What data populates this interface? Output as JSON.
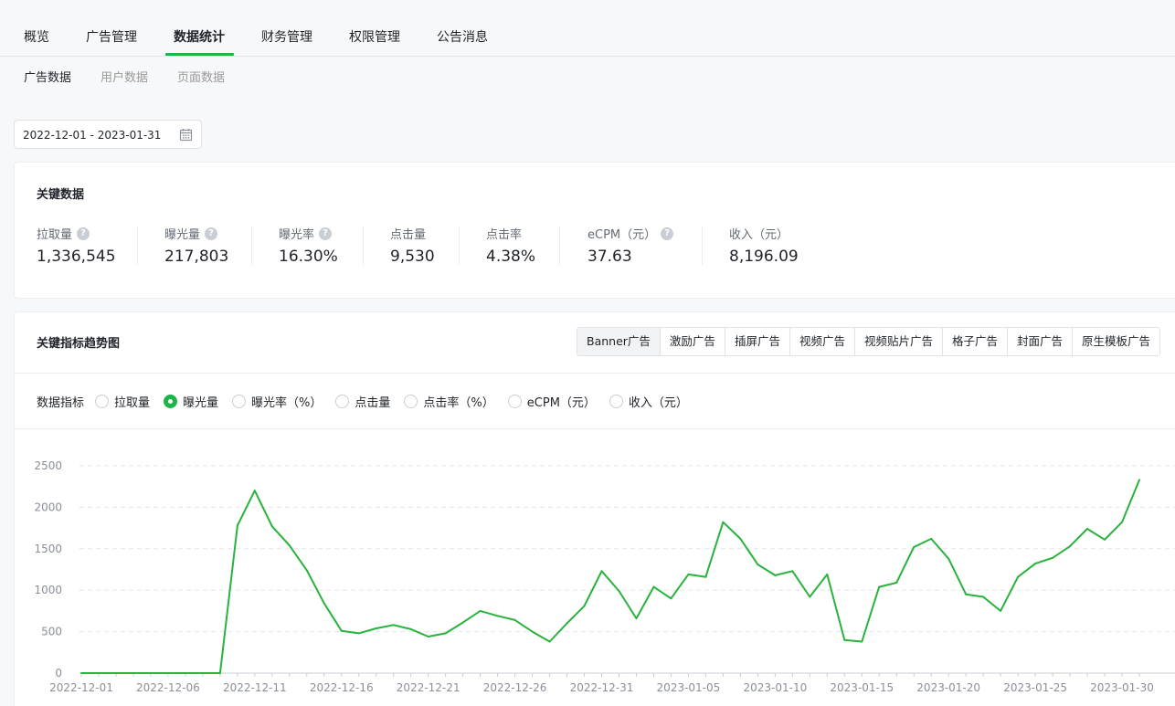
{
  "topnav": {
    "items": [
      {
        "label": "概览"
      },
      {
        "label": "广告管理"
      },
      {
        "label": "数据统计",
        "active": true
      },
      {
        "label": "财务管理"
      },
      {
        "label": "权限管理"
      },
      {
        "label": "公告消息"
      }
    ]
  },
  "subnav": {
    "items": [
      {
        "label": "广告数据",
        "active": true
      },
      {
        "label": "用户数据"
      },
      {
        "label": "页面数据"
      }
    ]
  },
  "date_range": {
    "value": "2022-12-01 - 2023-01-31",
    "icon": "calendar-icon"
  },
  "key_data": {
    "title": "关键数据",
    "metrics": [
      {
        "label": "拉取量",
        "value": "1,336,545",
        "help": true
      },
      {
        "label": "曝光量",
        "value": "217,803",
        "help": true
      },
      {
        "label": "曝光率",
        "value": "16.30%",
        "help": true
      },
      {
        "label": "点击量",
        "value": "9,530",
        "help": false
      },
      {
        "label": "点击率",
        "value": "4.38%",
        "help": false
      },
      {
        "label": "eCPM（元）",
        "value": "37.63",
        "help": true
      },
      {
        "label": "收入（元）",
        "value": "8,196.09",
        "help": false
      }
    ]
  },
  "trend": {
    "title": "关键指标趋势图",
    "ad_tabs": [
      "Banner广告",
      "激励广告",
      "插屏广告",
      "视频广告",
      "视频贴片广告",
      "格子广告",
      "封面广告",
      "原生模板广告"
    ],
    "active_tab": "Banner广告",
    "metric_label": "数据指标",
    "metric_options": [
      "拉取量",
      "曝光量",
      "曝光率（%）",
      "点击量",
      "点击率（%）",
      "eCPM（元）",
      "收入（元）"
    ],
    "selected_metric": "曝光量"
  },
  "colors": {
    "accent": "#1bb54a",
    "line": "#27b33c"
  },
  "chart_data": {
    "type": "line",
    "x": [
      "2022-12-01",
      "2022-12-02",
      "2022-12-03",
      "2022-12-04",
      "2022-12-05",
      "2022-12-06",
      "2022-12-07",
      "2022-12-08",
      "2022-12-09",
      "2022-12-10",
      "2022-12-11",
      "2022-12-12",
      "2022-12-13",
      "2022-12-14",
      "2022-12-15",
      "2022-12-16",
      "2022-12-17",
      "2022-12-18",
      "2022-12-19",
      "2022-12-20",
      "2022-12-21",
      "2022-12-22",
      "2022-12-23",
      "2022-12-24",
      "2022-12-25",
      "2022-12-26",
      "2022-12-27",
      "2022-12-28",
      "2022-12-29",
      "2022-12-30",
      "2022-12-31",
      "2023-01-01",
      "2023-01-02",
      "2023-01-03",
      "2023-01-04",
      "2023-01-05",
      "2023-01-06",
      "2023-01-07",
      "2023-01-08",
      "2023-01-09",
      "2023-01-10",
      "2023-01-11",
      "2023-01-12",
      "2023-01-13",
      "2023-01-14",
      "2023-01-15",
      "2023-01-16",
      "2023-01-17",
      "2023-01-18",
      "2023-01-19",
      "2023-01-20",
      "2023-01-21",
      "2023-01-22",
      "2023-01-23",
      "2023-01-24",
      "2023-01-25",
      "2023-01-26",
      "2023-01-27",
      "2023-01-28",
      "2023-01-29",
      "2023-01-30",
      "2023-01-31"
    ],
    "series": [
      {
        "values": [
          0,
          0,
          0,
          0,
          0,
          0,
          0,
          0,
          0,
          1780,
          2200,
          1770,
          1540,
          1240,
          840,
          510,
          480,
          540,
          580,
          530,
          440,
          480,
          610,
          750,
          690,
          640,
          500,
          380,
          600,
          810,
          1230,
          990,
          660,
          1040,
          900,
          1190,
          1160,
          1820,
          1620,
          1310,
          1180,
          1230,
          920,
          1190,
          400,
          380,
          1040,
          1090,
          1520,
          1620,
          1380,
          950,
          920,
          750,
          1160,
          1320,
          1390,
          1530,
          1740,
          1610,
          1820,
          2330
        ]
      }
    ],
    "x_ticks": [
      "2022-12-01",
      "2022-12-06",
      "2022-12-11",
      "2022-12-16",
      "2022-12-21",
      "2022-12-26",
      "2022-12-31",
      "2023-01-05",
      "2023-01-10",
      "2023-01-15",
      "2023-01-20",
      "2023-01-25",
      "2023-01-30"
    ],
    "y_ticks": [
      0,
      500,
      1000,
      1500,
      2000,
      2500
    ],
    "ylim": [
      0,
      2500
    ],
    "grid": "horizontal-dashed",
    "legend": "none"
  }
}
